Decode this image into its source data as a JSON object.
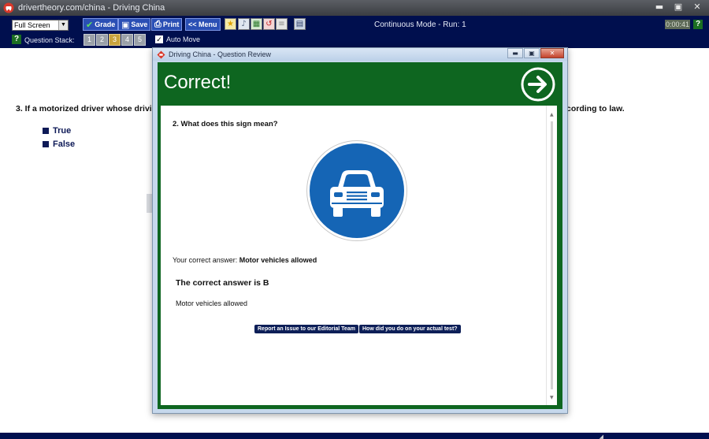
{
  "window": {
    "title": "drivertheory.com/china - Driving China",
    "controls": {
      "minimize": "▬",
      "maximize": "▣",
      "close": "✕"
    }
  },
  "toolbar": {
    "screen_mode": "Full Screen",
    "buttons": {
      "grade": "Grade",
      "save": "Save",
      "print": "Print",
      "menu": "<< Menu"
    },
    "mode_text": "Continuous Mode - Run: 1",
    "timer": "0:00:41",
    "help": "?",
    "question_stack_label": "Question Stack:",
    "question_stack": [
      "1",
      "2",
      "3",
      "4",
      "5"
    ],
    "question_stack_active": "3",
    "auto_move_label": "Auto Move",
    "auto_move_checked": "✓"
  },
  "background_question": {
    "text_start": "3. If a motorized driver whose drivi",
    "text_end": "cording to law.",
    "options": [
      "True",
      "False"
    ]
  },
  "dialog": {
    "title": "Driving China - Question Review",
    "banner": "Correct!",
    "question": "2. What does this sign mean?",
    "your_answer_label": "Your correct answer:",
    "your_answer_value": "Motor vehicles allowed",
    "correct_line": "The correct answer is B",
    "correct_text": "Motor vehicles allowed",
    "report_button": "Report an Issue to our Editorial Team",
    "actual_test_button": "How did you do on your actual test?"
  },
  "colors": {
    "toolbar_bg": "#000f4e",
    "banner_green": "#0e6620",
    "sign_blue": "#1565b5",
    "button_blue": "#2a4fb4"
  }
}
